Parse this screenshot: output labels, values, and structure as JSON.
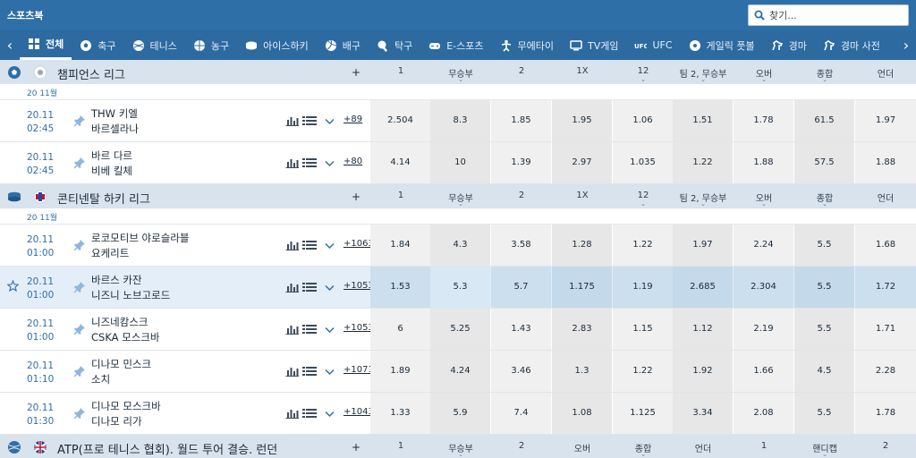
{
  "brand": "스포츠북",
  "search": {
    "placeholder": "찾기..."
  },
  "nav": {
    "items": [
      {
        "label": "전체",
        "icon": "grid-icon"
      },
      {
        "label": "축구",
        "icon": "soccer-icon"
      },
      {
        "label": "테니스",
        "icon": "tennis-icon"
      },
      {
        "label": "농구",
        "icon": "basketball-icon"
      },
      {
        "label": "아이스하키",
        "icon": "hockey-puck-icon"
      },
      {
        "label": "배구",
        "icon": "volleyball-icon"
      },
      {
        "label": "탁구",
        "icon": "table-tennis-icon"
      },
      {
        "label": "E-스포츠",
        "icon": "gamepad-icon"
      },
      {
        "label": "무에타이",
        "icon": "muay-thai-icon"
      },
      {
        "label": "TV게임",
        "icon": "tv-icon"
      },
      {
        "label": "UFC",
        "icon": "ufc-icon"
      },
      {
        "label": "게일릭 풋볼",
        "icon": "gaelic-football-icon"
      },
      {
        "label": "경마",
        "icon": "horse-icon"
      },
      {
        "label": "경마 사전",
        "icon": "horse-icon"
      }
    ]
  },
  "sections": [
    {
      "league": "챔피언스 리그",
      "plus": "+",
      "date": "20 11월",
      "headers": [
        {
          "label": "1",
          "chev": false
        },
        {
          "label": "무승부",
          "chev": true
        },
        {
          "label": "2",
          "chev": false
        },
        {
          "label": "1X",
          "chev": false
        },
        {
          "label": "12",
          "chev": true
        },
        {
          "label": "팀 2, 무승부",
          "chev": true
        },
        {
          "label": "오버",
          "chev": true
        },
        {
          "label": "종합",
          "chev": true
        },
        {
          "label": "언더",
          "chev": false
        }
      ],
      "matches": [
        {
          "date": "20.11",
          "time": "02:45",
          "home": "THW 키엘",
          "away": "바르셀라나",
          "more": "+89",
          "odds": [
            "2.504",
            "8.3",
            "1.85",
            "1.95",
            "1.06",
            "1.51",
            "1.78",
            "61.5",
            "1.97"
          ]
        },
        {
          "date": "20.11",
          "time": "02:45",
          "home": "바르 다르",
          "away": "비베 킬체",
          "more": "+80",
          "odds": [
            "4.14",
            "10",
            "1.39",
            "2.97",
            "1.035",
            "1.22",
            "1.88",
            "57.5",
            "1.88"
          ]
        }
      ]
    },
    {
      "league": "콘티넨탈 하키 리그",
      "plus": "+",
      "date": "20 11월",
      "headers": [
        {
          "label": "1",
          "chev": false
        },
        {
          "label": "무승부",
          "chev": true
        },
        {
          "label": "2",
          "chev": false
        },
        {
          "label": "1X",
          "chev": false
        },
        {
          "label": "12",
          "chev": true
        },
        {
          "label": "팀 2, 무승부",
          "chev": true
        },
        {
          "label": "오버",
          "chev": true
        },
        {
          "label": "종합",
          "chev": true
        },
        {
          "label": "언더",
          "chev": false
        }
      ],
      "matches": [
        {
          "date": "20.11",
          "time": "01:00",
          "home": "로코모티브 야로슬라블",
          "away": "요케리트",
          "more": "+1063",
          "odds": [
            "1.84",
            "4.3",
            "3.58",
            "1.28",
            "1.22",
            "1.97",
            "2.24",
            "5.5",
            "1.68"
          ]
        },
        {
          "date": "20.11",
          "time": "01:00",
          "home": "바르스 카잔",
          "away": "니즈니 노브고로드",
          "more": "+1053",
          "odds": [
            "1.53",
            "5.3",
            "5.7",
            "1.175",
            "1.19",
            "2.685",
            "2.304",
            "5.5",
            "1.72"
          ]
        },
        {
          "date": "20.11",
          "time": "01:00",
          "home": "니즈네캄스크",
          "away": "CSKA 모스크바",
          "more": "+1053",
          "odds": [
            "6",
            "5.25",
            "1.43",
            "2.83",
            "1.15",
            "1.12",
            "2.19",
            "5.5",
            "1.71"
          ]
        },
        {
          "date": "20.11",
          "time": "01:10",
          "home": "디나모 민스크",
          "away": "소치",
          "more": "+1071",
          "odds": [
            "1.89",
            "4.24",
            "3.46",
            "1.3",
            "1.22",
            "1.92",
            "1.66",
            "4.5",
            "2.28"
          ]
        },
        {
          "date": "20.11",
          "time": "01:30",
          "home": "디나모 모스크바",
          "away": "디나모 리가",
          "more": "+1043",
          "odds": [
            "1.33",
            "5.9",
            "7.4",
            "1.08",
            "1.125",
            "3.34",
            "2.08",
            "5.5",
            "1.78"
          ]
        }
      ]
    },
    {
      "league": "ATP(프로 테니스 협회). 월드 투어 결승. 런던",
      "plus": "+",
      "headers": [
        {
          "label": "1",
          "chev": false
        },
        {
          "label": "무승부",
          "chev": true
        },
        {
          "label": "2",
          "chev": false
        },
        {
          "label": "오버",
          "chev": false
        },
        {
          "label": "종합",
          "chev": true
        },
        {
          "label": "언더",
          "chev": false
        },
        {
          "label": "1",
          "chev": false
        },
        {
          "label": "핸디캡",
          "chev": true
        },
        {
          "label": "2",
          "chev": false
        }
      ]
    }
  ],
  "colors": {
    "header": "#2f6fa8",
    "nav": "#2c6aa0",
    "league_bg": "#d9e3ee",
    "time": "#2f6fa8",
    "highlight": "#e4eef8"
  }
}
